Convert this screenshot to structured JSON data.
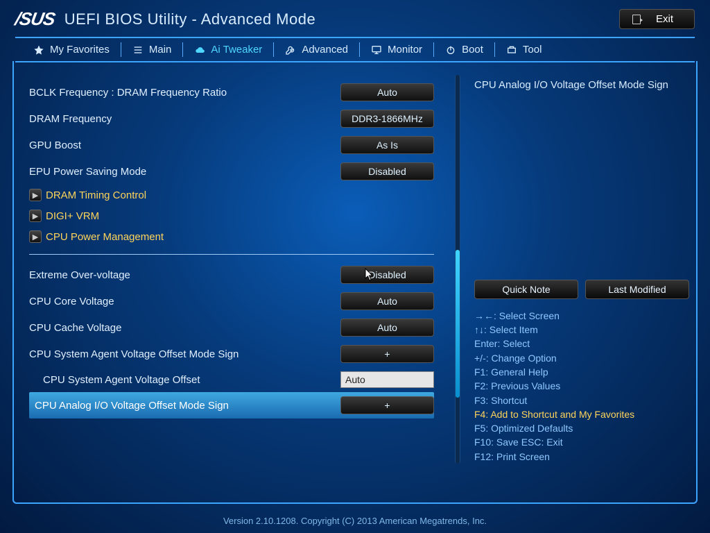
{
  "header": {
    "brand": "/SUS",
    "title": "UEFI BIOS Utility - Advanced Mode",
    "exit": "Exit"
  },
  "tabs": [
    {
      "id": "favorites",
      "label": "My Favorites"
    },
    {
      "id": "main",
      "label": "Main"
    },
    {
      "id": "aitweaker",
      "label": "Ai Tweaker"
    },
    {
      "id": "advanced",
      "label": "Advanced"
    },
    {
      "id": "monitor",
      "label": "Monitor"
    },
    {
      "id": "boot",
      "label": "Boot"
    },
    {
      "id": "tool",
      "label": "Tool"
    }
  ],
  "settings": {
    "bclk_ratio": {
      "label": "BCLK Frequency : DRAM Frequency Ratio",
      "value": "Auto"
    },
    "dram_freq": {
      "label": "DRAM Frequency",
      "value": "DDR3-1866MHz"
    },
    "gpu_boost": {
      "label": "GPU Boost",
      "value": "As Is"
    },
    "epu": {
      "label": "EPU Power Saving Mode",
      "value": "Disabled"
    },
    "dram_timing": {
      "label": "DRAM Timing Control"
    },
    "digi_vrm": {
      "label": "DIGI+ VRM"
    },
    "cpu_pm": {
      "label": "CPU Power Management"
    },
    "extreme_ov": {
      "label": "Extreme Over-voltage",
      "value": "Disabled"
    },
    "cpu_core_v": {
      "label": "CPU Core Voltage",
      "value": "Auto"
    },
    "cpu_cache_v": {
      "label": "CPU Cache Voltage",
      "value": "Auto"
    },
    "sa_sign": {
      "label": "CPU System Agent Voltage Offset Mode Sign",
      "value": "+"
    },
    "sa_offset": {
      "label": "CPU System Agent Voltage Offset",
      "value": "Auto"
    },
    "analog_sign": {
      "label": "CPU Analog I/O Voltage Offset Mode Sign",
      "value": "+"
    }
  },
  "help": {
    "title": "CPU Analog I/O Voltage Offset Mode Sign",
    "quick_note": "Quick Note",
    "last_modified": "Last Modified"
  },
  "hints": {
    "select_screen": "→←: Select Screen",
    "select_item": "↑↓: Select Item",
    "enter": "Enter: Select",
    "change": "+/-: Change Option",
    "f1": "F1: General Help",
    "f2": "F2: Previous Values",
    "f3": "F3: Shortcut",
    "f4": "F4: Add to Shortcut and My Favorites",
    "f5": "F5: Optimized Defaults",
    "f10": "F10: Save  ESC: Exit",
    "f12": "F12: Print Screen"
  },
  "footer": "Version 2.10.1208. Copyright (C) 2013 American Megatrends, Inc."
}
